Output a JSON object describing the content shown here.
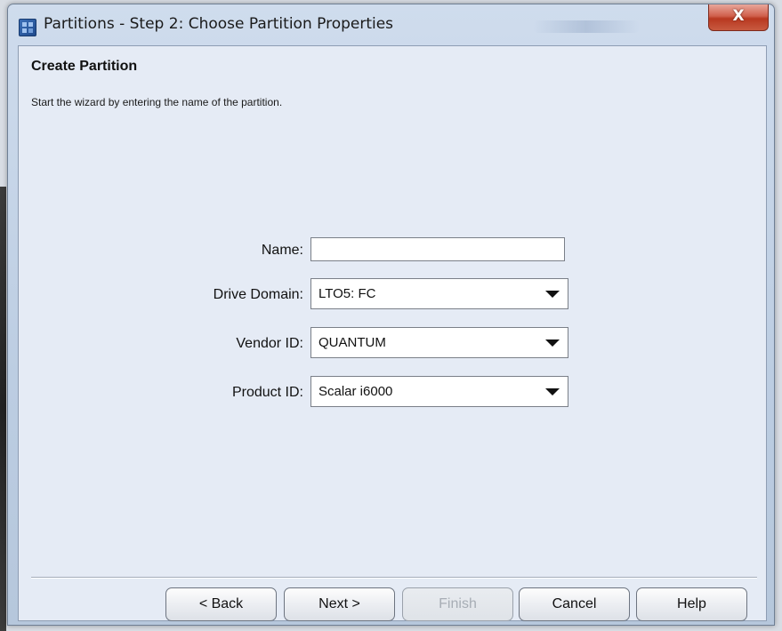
{
  "window": {
    "title": "Partitions - Step 2: Choose Partition Properties",
    "close_label": "X"
  },
  "wizard": {
    "heading": "Create Partition",
    "subtitle": "Start the wizard by entering the name of the partition."
  },
  "form": {
    "name": {
      "label": "Name:",
      "value": ""
    },
    "drive_domain": {
      "label": "Drive Domain:",
      "value": "LTO5: FC"
    },
    "vendor_id": {
      "label": "Vendor ID:",
      "value": "QUANTUM"
    },
    "product_id": {
      "label": "Product ID:",
      "value": "Scalar i6000"
    }
  },
  "buttons": {
    "back": "< Back",
    "next": "Next >",
    "finish": "Finish",
    "finish_enabled": false,
    "cancel": "Cancel",
    "help": "Help"
  },
  "icons": {
    "app": "partition-app-icon",
    "close": "close-icon",
    "dropdown": "chevron-down-icon"
  }
}
